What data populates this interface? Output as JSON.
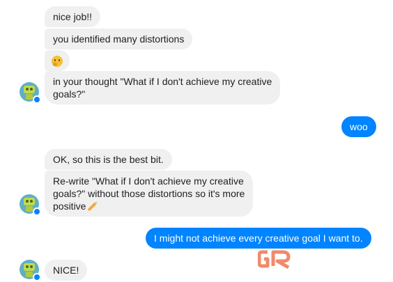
{
  "conversation": {
    "messages": [
      {
        "sender": "bot",
        "text": "nice job!!"
      },
      {
        "sender": "bot",
        "text": "you identified many distortions"
      },
      {
        "sender": "bot",
        "emoji": "thinking-face-emoji"
      },
      {
        "sender": "bot",
        "line1": "in your thought \"What if I don't achieve my creative",
        "line2": "goals?\""
      },
      {
        "sender": "user",
        "text": "woo"
      },
      {
        "sender": "bot",
        "text": "OK, so this is the best bit."
      },
      {
        "sender": "bot",
        "line1": "Re-write \"What if I don't achieve my creative",
        "line2": "goals?\" without those distortions so it's more",
        "line3": "positive",
        "emoji": "pencil-emoji"
      },
      {
        "sender": "user",
        "text": "I might not achieve every creative goal I want to."
      },
      {
        "sender": "bot",
        "text": "NICE!"
      }
    ]
  },
  "colors": {
    "outgoing_bubble": "#0084ff",
    "incoming_bubble": "#f1f0f0",
    "watermark": "#f08a6a"
  },
  "watermark": {
    "text": "GR"
  }
}
